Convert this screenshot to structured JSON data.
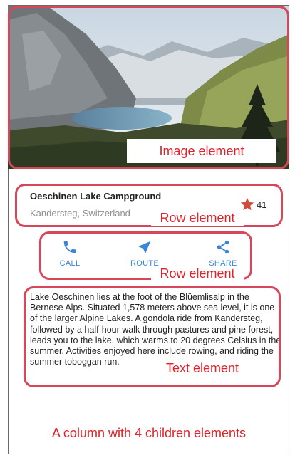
{
  "callouts": {
    "image": "Image element",
    "title_row": "Row element",
    "buttons_row": "Row element",
    "text": "Text element",
    "column": "A column with 4 children elements"
  },
  "title_section": {
    "title": "Oeschinen Lake Campground",
    "subtitle": "Kandersteg, Switzerland",
    "favorite_count": "41",
    "star_color": "#d04a3c"
  },
  "buttons": [
    {
      "label": "CALL",
      "icon": "phone-icon"
    },
    {
      "label": "ROUTE",
      "icon": "navigation-icon"
    },
    {
      "label": "SHARE",
      "icon": "share-icon"
    }
  ],
  "accent_color": "#3b85d8",
  "description": "Lake Oeschinen lies at the foot of the Blüemlisalp in the Bernese Alps. Situated 1,578 meters above sea level, it is one of the larger Alpine Lakes. A gondola ride from Kandersteg, followed by a half-hour walk through pastures and pine forest, leads you to the lake, which warms to 20 degrees Celsius in the summer. Activities enjoyed here include rowing, and riding the summer toboggan run."
}
